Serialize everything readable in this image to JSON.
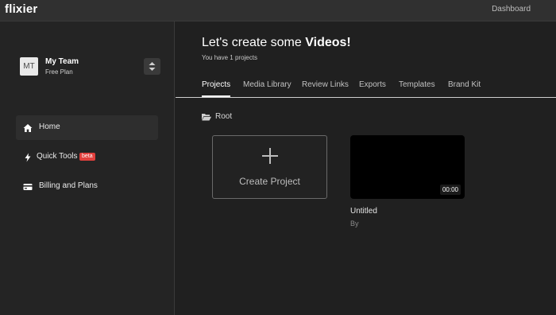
{
  "app": {
    "logo": "flixier",
    "dashboard_link": "Dashboard"
  },
  "team": {
    "avatar_initials": "MT",
    "name": "My Team",
    "plan": "Free Plan"
  },
  "nav": [
    {
      "label": "Home",
      "icon": "home-icon",
      "active": true
    },
    {
      "label": "Quick Tools",
      "icon": "bolt-icon",
      "badge": "beta"
    },
    {
      "label": "Billing and Plans",
      "icon": "credit-card-icon"
    }
  ],
  "header": {
    "title_prefix": "Let's create some ",
    "title_bold": "Videos!",
    "subtitle": "You have 1 projects"
  },
  "tabs": [
    "Projects",
    "Media Library",
    "Review Links",
    "Exports",
    "Templates",
    "Brand Kit"
  ],
  "active_tab": "Projects",
  "breadcrumb": {
    "label": "Root",
    "icon": "folder-open-icon"
  },
  "create_card": {
    "label": "Create Project",
    "icon": "plus-icon"
  },
  "projects": [
    {
      "title": "Untitled",
      "by": "By",
      "duration": "00:00"
    }
  ]
}
